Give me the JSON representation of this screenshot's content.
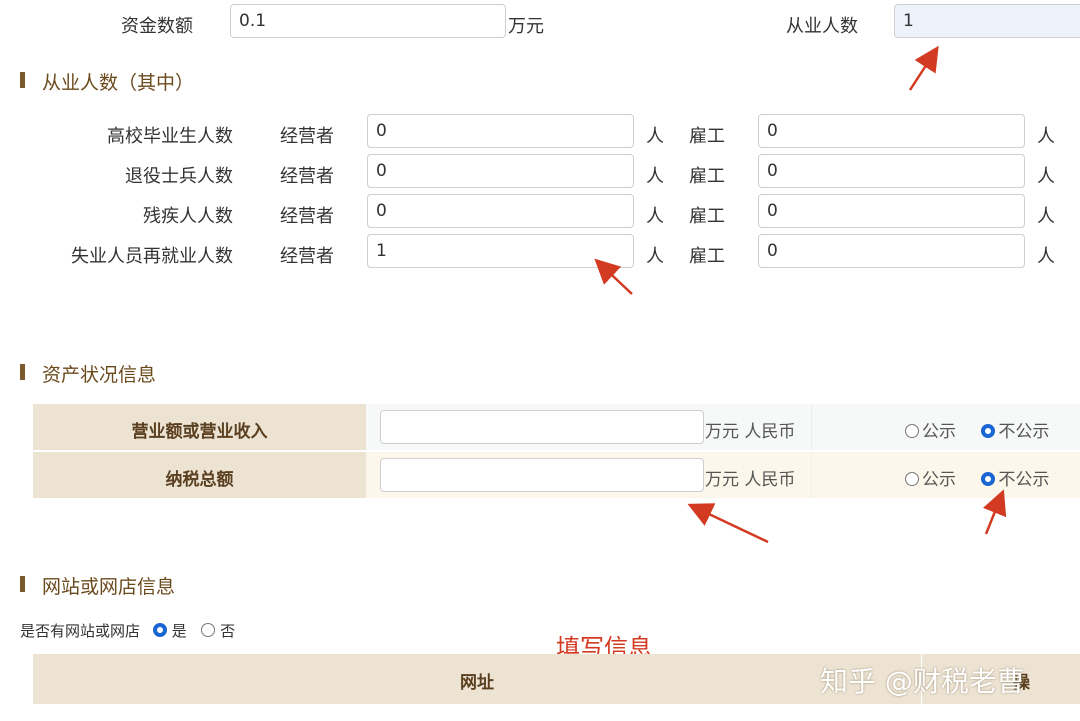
{
  "top": {
    "capital_label": "资金数额",
    "capital_value": "0.1",
    "capital_unit": "万元",
    "employees_label": "从业人数",
    "employees_value": "1"
  },
  "section_employees": {
    "title": "从业人数（其中）",
    "operator_label": "经营者",
    "employee_label": "雇工",
    "unit": "人",
    "rows": [
      {
        "label": "高校毕业生人数",
        "operator": "0",
        "employee": "0"
      },
      {
        "label": "退役士兵人数",
        "operator": "0",
        "employee": "0"
      },
      {
        "label": "残疾人人数",
        "operator": "0",
        "employee": "0"
      },
      {
        "label": "失业人员再就业人数",
        "operator": "1",
        "employee": "0"
      }
    ]
  },
  "section_assets": {
    "title": "资产状况信息",
    "public_label": "公示",
    "private_label": "不公示",
    "rows": [
      {
        "label": "营业额或营业收入",
        "value": "",
        "unit": "万元 人民币",
        "public": false
      },
      {
        "label": "纳税总额",
        "value": "",
        "unit": "万元 人民币",
        "public": false
      }
    ]
  },
  "section_website": {
    "title": "网站或网店信息",
    "question": "是否有网站或网店",
    "yes_label": "是",
    "no_label": "否",
    "has_website": true,
    "table_header_url": "网址",
    "table_header_action": "操"
  },
  "annotations": {
    "fill_info": "填写信息",
    "watermark": "知乎 @财税老曹"
  },
  "colors": {
    "section_title": "#6b4a1e",
    "label_cell_bg": "#ede3d3",
    "row_bg_alt": "#fdf6ea",
    "arrow": "#d33a22",
    "radio_selected": "#1a66d2"
  }
}
